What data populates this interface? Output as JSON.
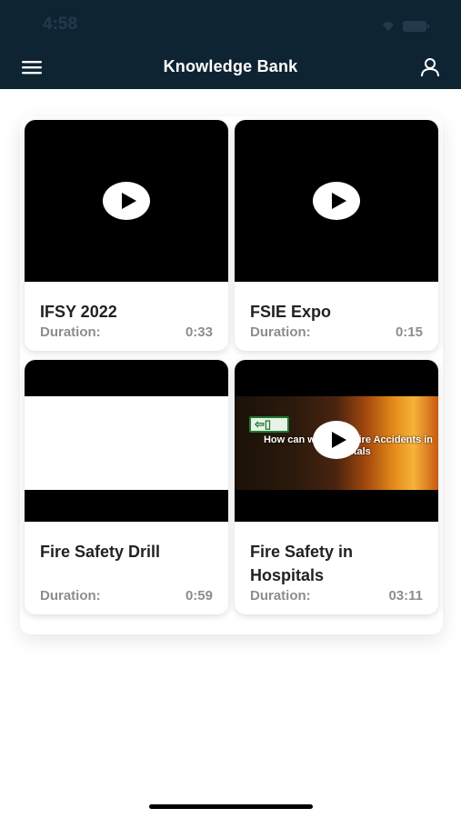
{
  "status_bar": {
    "time": "4:58"
  },
  "header": {
    "title": "Knowledge Bank"
  },
  "videos": [
    {
      "title": "IFSY 2022",
      "duration_label": "Duration:",
      "duration": "0:33"
    },
    {
      "title": "FSIE Expo",
      "duration_label": "Duration:",
      "duration": "0:15"
    },
    {
      "title": "Fire Safety Drill",
      "duration_label": "Duration:",
      "duration": "0:59"
    },
    {
      "title": "Fire Safety in Hospitals",
      "duration_label": "Duration:",
      "duration": "03:11",
      "thumbnail_text": "How can we avoid Fire Accidents in Hospitals"
    }
  ],
  "colors": {
    "header_bg": "#0f2433",
    "text_muted": "#8d8d8d"
  }
}
